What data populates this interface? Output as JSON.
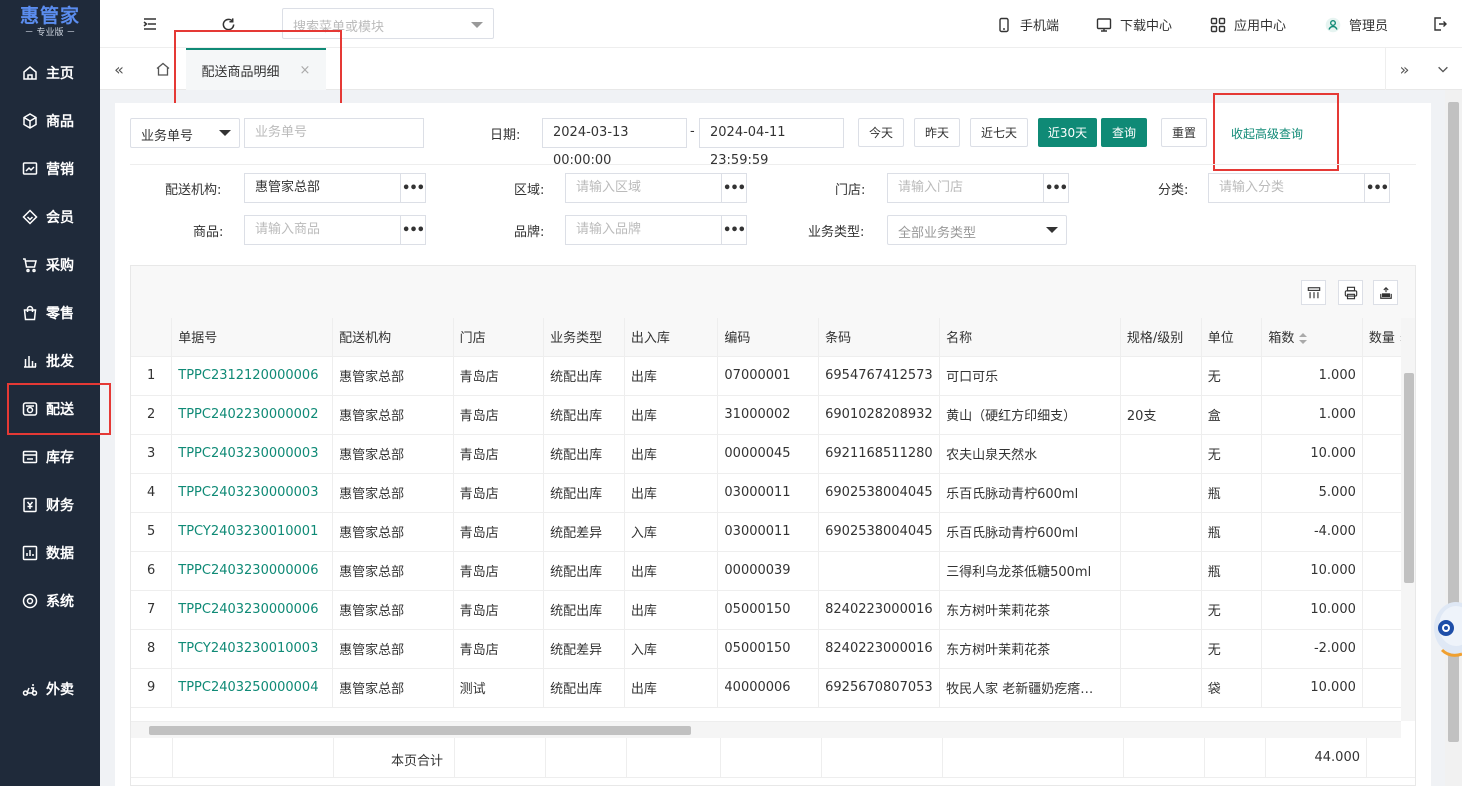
{
  "logo": {
    "main": "惠管家",
    "sub": "－ 专业版 －"
  },
  "nav": [
    {
      "label": "主页",
      "icon": "home-icon"
    },
    {
      "label": "商品",
      "icon": "box-icon"
    },
    {
      "label": "营销",
      "icon": "chart-icon"
    },
    {
      "label": "会员",
      "icon": "diamond-icon"
    },
    {
      "label": "采购",
      "icon": "cart-icon"
    },
    {
      "label": "零售",
      "icon": "bag-icon"
    },
    {
      "label": "批发",
      "icon": "bars-icon"
    },
    {
      "label": "配送",
      "icon": "truck-icon"
    },
    {
      "label": "库存",
      "icon": "warehouse-icon"
    },
    {
      "label": "财务",
      "icon": "finance-icon"
    },
    {
      "label": "数据",
      "icon": "data-icon"
    },
    {
      "label": "系统",
      "icon": "gear-icon"
    },
    {
      "label": "外卖",
      "icon": "delivery-icon"
    }
  ],
  "topbar": {
    "search_placeholder": "搜索菜单或模块",
    "mobile": "手机端",
    "download": "下载中心",
    "apps": "应用中心",
    "user": "管理员"
  },
  "tabs": {
    "active": "配送商品明细",
    "close": "×"
  },
  "filters": {
    "biz_no_type": "业务单号",
    "biz_no_placeholder": "业务单号",
    "date_label": "日期:",
    "date_start": "2024-03-13 00:00:00",
    "date_sep": "-",
    "date_end": "2024-04-11 23:59:59",
    "btn_today": "今天",
    "btn_yesterday": "昨天",
    "btn_7days": "近七天",
    "btn_30days": "近30天",
    "btn_query": "查询",
    "btn_reset": "重置",
    "collapse_link": "收起高级查询",
    "org_label": "配送机构:",
    "org_value": "惠管家总部",
    "region_label": "区域:",
    "region_placeholder": "请输入区域",
    "store_label": "门店:",
    "store_placeholder": "请输入门店",
    "category_label": "分类:",
    "category_placeholder": "请输入分类",
    "product_label": "商品:",
    "product_placeholder": "请输入商品",
    "brand_label": "品牌:",
    "brand_placeholder": "请输入品牌",
    "biztype_label": "业务类型:",
    "biztype_value": "全部业务类型",
    "dots": "•••"
  },
  "table": {
    "columns": [
      "",
      "单据号",
      "配送机构",
      "门店",
      "业务类型",
      "出入库",
      "编码",
      "条码",
      "名称",
      "规格/级别",
      "单位",
      "箱数",
      "数量"
    ],
    "rows": [
      [
        "1",
        "TPPC2312120000006",
        "惠管家总部",
        "青岛店",
        "统配出库",
        "出库",
        "07000001",
        "6954767412573",
        "可口可乐",
        "",
        "无",
        "1.000"
      ],
      [
        "2",
        "TPPC2402230000002",
        "惠管家总部",
        "青岛店",
        "统配出库",
        "出库",
        "31000002",
        "6901028208932",
        "黄山（硬红方印细支）",
        "20支",
        "盒",
        "1.000"
      ],
      [
        "3",
        "TPPC2403230000003",
        "惠管家总部",
        "青岛店",
        "统配出库",
        "出库",
        "00000045",
        "6921168511280",
        "农夫山泉天然水",
        "",
        "无",
        "10.000"
      ],
      [
        "4",
        "TPPC2403230000003",
        "惠管家总部",
        "青岛店",
        "统配出库",
        "出库",
        "03000011",
        "6902538004045",
        "乐百氏脉动青柠600ml",
        "",
        "瓶",
        "5.000"
      ],
      [
        "5",
        "TPCY2403230010001",
        "惠管家总部",
        "青岛店",
        "统配差异",
        "入库",
        "03000011",
        "6902538004045",
        "乐百氏脉动青柠600ml",
        "",
        "瓶",
        "-4.000"
      ],
      [
        "6",
        "TPPC2403230000006",
        "惠管家总部",
        "青岛店",
        "统配出库",
        "出库",
        "00000039",
        "",
        "三得利乌龙茶低糖500ml",
        "",
        "瓶",
        "10.000"
      ],
      [
        "7",
        "TPPC2403230000006",
        "惠管家总部",
        "青岛店",
        "统配出库",
        "出库",
        "05000150",
        "8240223000016",
        "东方树叶茉莉花茶",
        "",
        "无",
        "10.000"
      ],
      [
        "8",
        "TPCY2403230010003",
        "惠管家总部",
        "青岛店",
        "统配差异",
        "入库",
        "05000150",
        "8240223000016",
        "东方树叶茉莉花茶",
        "",
        "无",
        "-2.000"
      ],
      [
        "9",
        "TPPC2403250000004",
        "惠管家总部",
        "测试",
        "统配出库",
        "出库",
        "40000006",
        "6925670807053",
        "牧民人家 老新疆奶疙瘩…",
        "",
        "袋",
        "10.000"
      ]
    ],
    "footer_label": "本页合计",
    "footer_total": "44.000"
  }
}
